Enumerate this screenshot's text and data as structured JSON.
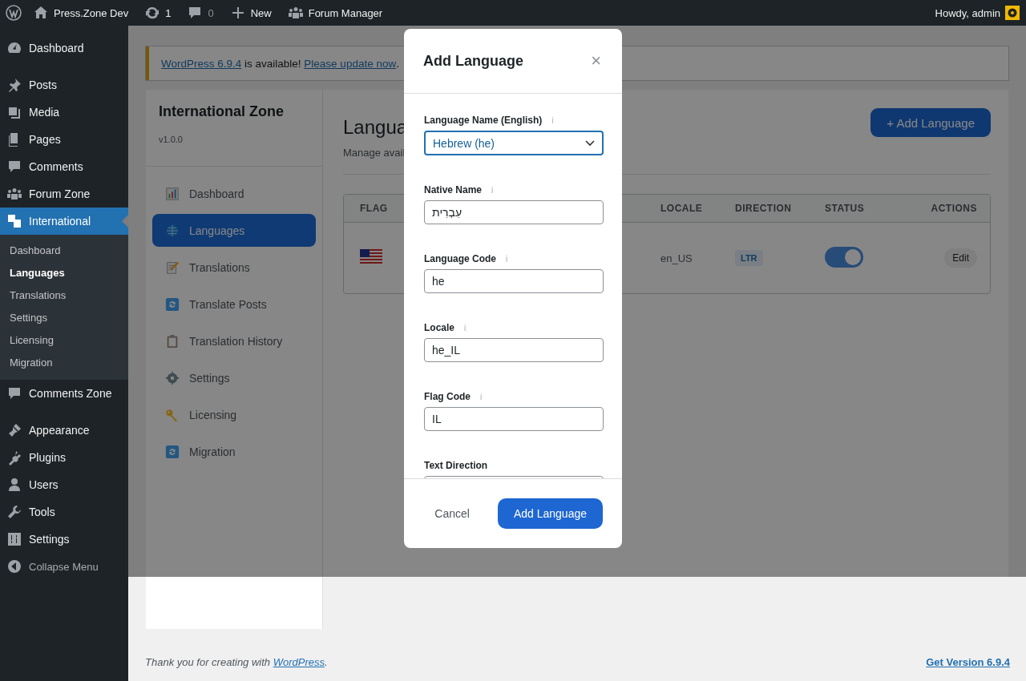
{
  "admin_bar": {
    "site": "Press.Zone Dev",
    "updates": "1",
    "comments": "0",
    "new": "New",
    "forum": "Forum Manager",
    "greeting": "Howdy, admin"
  },
  "sidebar": {
    "groups": [
      {
        "items": [
          {
            "label": "Dashboard",
            "current": false
          }
        ]
      },
      {
        "items": [
          {
            "label": "Posts",
            "current": false
          },
          {
            "label": "Media",
            "current": false
          },
          {
            "label": "Pages",
            "current": false
          },
          {
            "label": "Comments",
            "current": false
          },
          {
            "label": "Forum Zone",
            "current": false
          },
          {
            "label": "International",
            "current": true,
            "submenu": [
              {
                "label": "Dashboard",
                "selected": false
              },
              {
                "label": "Languages",
                "selected": true
              },
              {
                "label": "Translations",
                "selected": false
              },
              {
                "label": "Settings",
                "selected": false
              },
              {
                "label": "Licensing",
                "selected": false
              },
              {
                "label": "Migration",
                "selected": false
              }
            ]
          },
          {
            "label": "Comments Zone",
            "current": false
          }
        ]
      },
      {
        "items": [
          {
            "label": "Appearance",
            "current": false
          },
          {
            "label": "Plugins",
            "current": false
          },
          {
            "label": "Users",
            "current": false
          },
          {
            "label": "Tools",
            "current": false
          },
          {
            "label": "Settings",
            "current": false
          }
        ]
      }
    ],
    "collapse": "Collapse Menu"
  },
  "notice": {
    "link": "WordPress 6.9.4",
    "text": " is available! ",
    "action": "Please update now",
    "end": "."
  },
  "plugin": {
    "title": "International Zone",
    "version": "v1.0.0",
    "nav": [
      {
        "label": "Dashboard",
        "selected": false
      },
      {
        "label": "Languages",
        "selected": true
      },
      {
        "label": "Translations",
        "selected": false
      },
      {
        "label": "Translate Posts",
        "selected": false
      },
      {
        "label": "Translation History",
        "selected": false
      },
      {
        "label": "Settings",
        "selected": false
      },
      {
        "label": "Licensing",
        "selected": false
      },
      {
        "label": "Migration",
        "selected": false
      }
    ]
  },
  "page": {
    "heading": "Langua",
    "subtitle": "Manage avail",
    "add_button": "+ Add Language",
    "table": {
      "columns": [
        "FLAG",
        "LOCALE",
        "DIRECTION",
        "STATUS",
        "ACTIONS"
      ],
      "rows": [
        {
          "locale": "en_US",
          "direction": "LTR",
          "active": true,
          "action": "Edit"
        }
      ]
    }
  },
  "modal": {
    "title": "Add Language",
    "close": "×",
    "fields": [
      {
        "kind": "select",
        "label": "Language Name (English)",
        "info": "i",
        "value": "Hebrew (he)",
        "focused": true
      },
      {
        "kind": "text",
        "label": "Native Name",
        "info": "i",
        "value": "עִבְרִית",
        "focused": false
      },
      {
        "kind": "text",
        "label": "Language Code",
        "info": "i",
        "value": "he",
        "focused": false
      },
      {
        "kind": "text",
        "label": "Locale",
        "info": "i",
        "value": "he_IL",
        "focused": false
      },
      {
        "kind": "text",
        "label": "Flag Code",
        "info": "i",
        "value": "IL",
        "focused": false
      },
      {
        "kind": "text",
        "label": "Text Direction",
        "focused": false
      }
    ],
    "cancel": "Cancel",
    "submit": "Add Language"
  },
  "footer": {
    "text": "Thank you for creating with ",
    "link": "WordPress",
    "end": ".",
    "version": "Get Version 6.9.4"
  }
}
